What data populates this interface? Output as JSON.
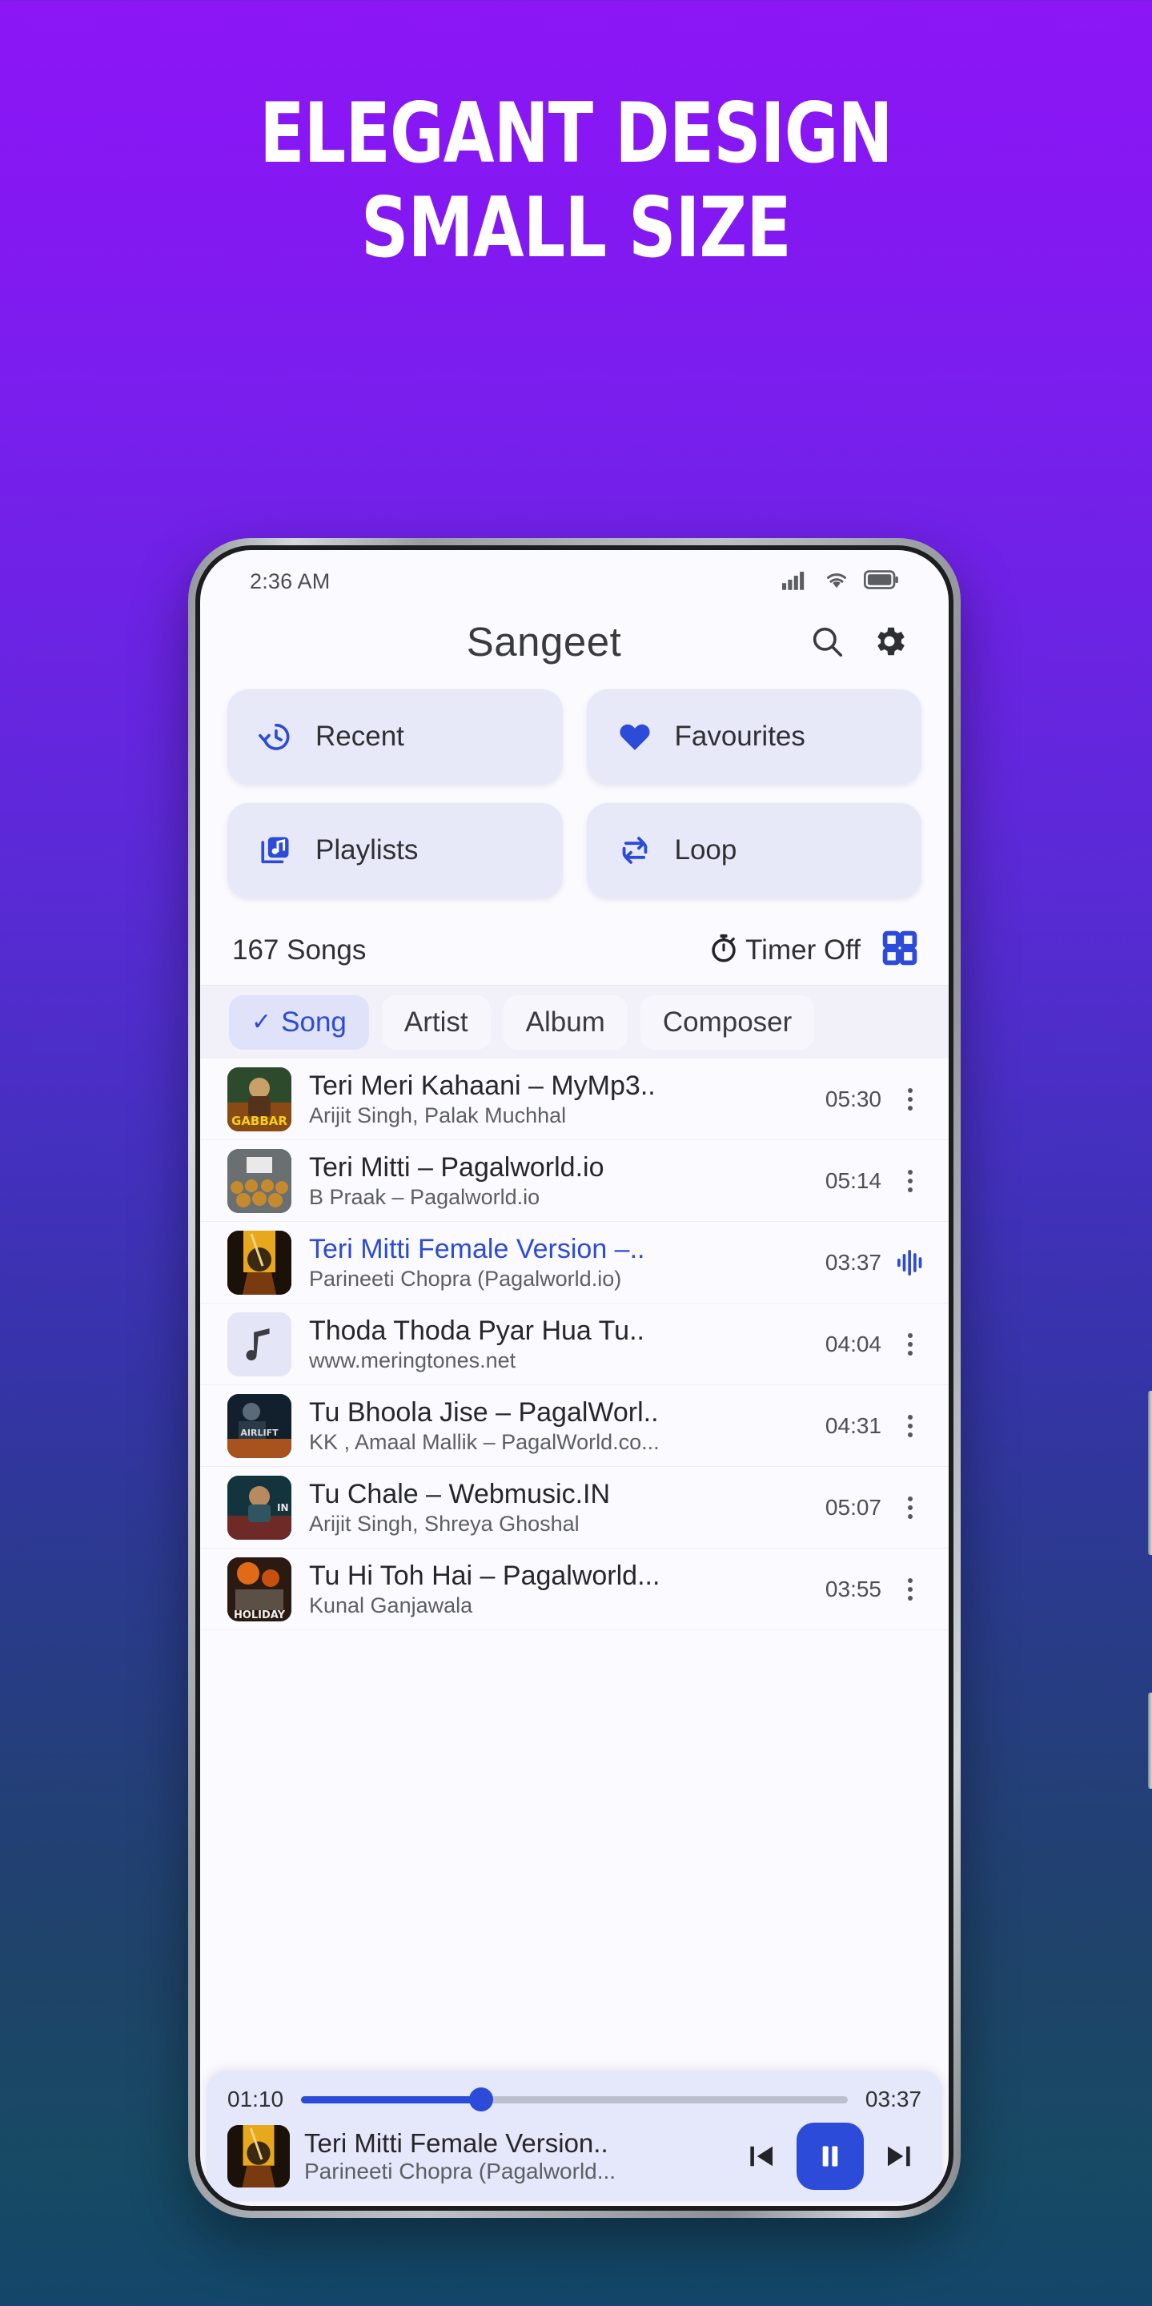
{
  "promo": {
    "line1": "ELEGANT DESIGN",
    "line2": "SMALL SIZE",
    "bg_top": "#8c16f6",
    "bg_bottom": "#13466a"
  },
  "statusbar": {
    "time": "2:36 AM",
    "icons": [
      "signal-icon",
      "wifi-icon",
      "battery-icon"
    ]
  },
  "appbar": {
    "title": "Sangeet",
    "search_icon": "search-icon",
    "settings_icon": "gear-icon"
  },
  "quick_actions": [
    {
      "label": "Recent",
      "icon": "history-icon"
    },
    {
      "label": "Favourites",
      "icon": "heart-icon"
    },
    {
      "label": "Playlists",
      "icon": "playlist-icon"
    },
    {
      "label": "Loop",
      "icon": "loop-icon"
    }
  ],
  "meta": {
    "songs_count": "167 Songs",
    "timer_label": "Timer Off",
    "timer_icon": "stopwatch-icon",
    "grid_icon": "grid-view-icon"
  },
  "tabs": [
    {
      "label": "Song",
      "active": true,
      "check": "✓"
    },
    {
      "label": "Artist",
      "active": false
    },
    {
      "label": "Album",
      "active": false
    },
    {
      "label": "Composer",
      "active": false
    }
  ],
  "songs": [
    {
      "title": "Teri Meri Kahaani – MyMp3..",
      "artist": "Arijit Singh, Palak Muchhal",
      "duration": "05:30",
      "playing": false,
      "art": "gabbar"
    },
    {
      "title": "Teri Mitti – Pagalworld.io",
      "artist": "B Praak – Pagalworld.io",
      "duration": "05:14",
      "playing": false,
      "art": "kesari-crowd"
    },
    {
      "title": "Teri Mitti Female Version –..",
      "artist": "Parineeti Chopra (Pagalworld.io)",
      "duration": "03:37",
      "playing": true,
      "art": "kesari"
    },
    {
      "title": "Thoda Thoda Pyar Hua Tu..",
      "artist": "www.meringtones.net",
      "duration": "04:04",
      "playing": false,
      "art": "placeholder"
    },
    {
      "title": "Tu Bhoola Jise – PagalWorl..",
      "artist": "KK , Amaal Mallik – PagalWorld.co...",
      "duration": "04:31",
      "playing": false,
      "art": "airlift"
    },
    {
      "title": "Tu Chale – Webmusic.IN",
      "artist": "Arijit Singh, Shreya Ghoshal",
      "duration": "05:07",
      "playing": false,
      "art": "iaction"
    },
    {
      "title": "Tu Hi Toh Hai – Pagalworld...",
      "artist": "Kunal Ganjawala",
      "duration": "03:55",
      "playing": false,
      "art": "holiday"
    }
  ],
  "player": {
    "elapsed": "01:10",
    "total": "03:37",
    "progress_percent": 33,
    "title": "Teri Mitti Female Version..",
    "artist": "Parineeti Chopra (Pagalworld...",
    "prev_icon": "skip-previous-icon",
    "play_icon": "pause-icon",
    "next_icon": "skip-next-icon",
    "accent": "#2b4bd8"
  }
}
